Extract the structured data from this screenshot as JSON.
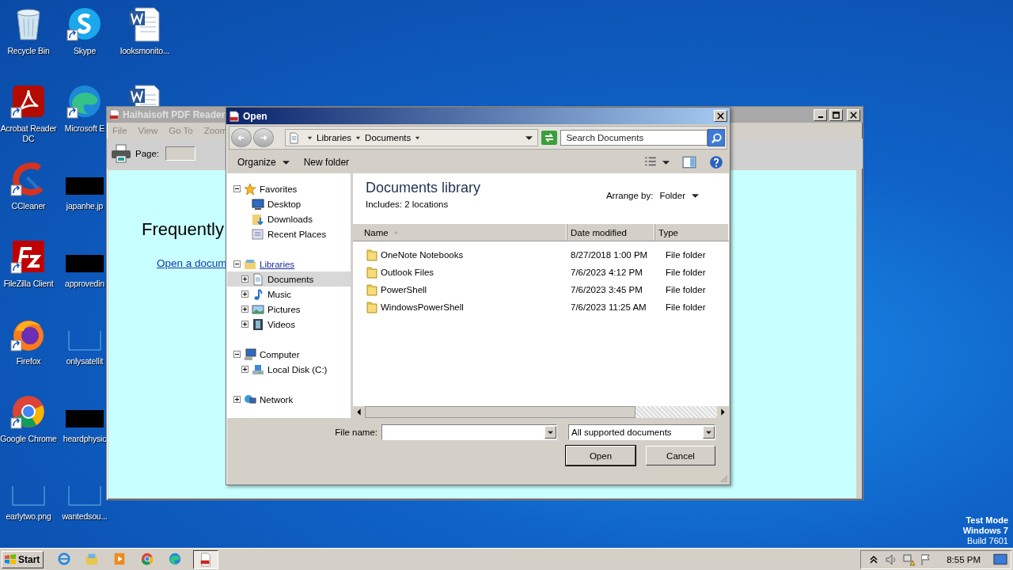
{
  "desktop": {
    "icons": [
      {
        "label": "Recycle Bin",
        "kind": "recycle",
        "shortcut": false
      },
      {
        "label": "Acrobat Reader DC",
        "kind": "acrobat",
        "shortcut": true
      },
      {
        "label": "CCleaner",
        "kind": "ccleaner",
        "shortcut": true
      },
      {
        "label": "FileZilla Client",
        "kind": "filezilla",
        "shortcut": true
      },
      {
        "label": "Firefox",
        "kind": "firefox",
        "shortcut": true
      },
      {
        "label": "Google Chrome",
        "kind": "chrome",
        "shortcut": true
      },
      {
        "label": "earlytwo.png",
        "kind": "blank",
        "shortcut": false
      },
      {
        "label": "Skype",
        "kind": "skype",
        "shortcut": true
      },
      {
        "label": "Microsoft E",
        "kind": "edge",
        "shortcut": true
      },
      {
        "label": "japanhe.jp",
        "kind": "redacted",
        "shortcut": false
      },
      {
        "label": "approvedin",
        "kind": "redacted",
        "shortcut": false
      },
      {
        "label": "onlysatellit",
        "kind": "blank",
        "shortcut": false
      },
      {
        "label": "heardphysic",
        "kind": "redacted",
        "shortcut": false
      },
      {
        "label": "wantedsou...",
        "kind": "blank",
        "shortcut": false
      },
      {
        "label": "looksmonito...",
        "kind": "word",
        "shortcut": false
      },
      {
        "kind": "word"
      }
    ]
  },
  "pdf_reader": {
    "title": "Haihaisoft PDF Reader",
    "menu": [
      "File",
      "View",
      "Go To",
      "Zoom"
    ],
    "page_label": "Page:",
    "heading": "Frequently",
    "link": "Open a docum"
  },
  "open_dialog": {
    "title": "Open",
    "breadcrumb": [
      "Libraries",
      "Documents"
    ],
    "search": {
      "placeholder": "Search Documents"
    },
    "toolbar": {
      "organize": "Organize",
      "new_folder": "New folder"
    },
    "navigation": [
      {
        "label": "Favorites",
        "kind": "star",
        "expanded": true,
        "selected": false,
        "hovered": false,
        "children": [
          {
            "label": "Desktop",
            "kind": "desktop",
            "selected": false,
            "hovered": false
          },
          {
            "label": "Downloads",
            "kind": "downloads",
            "selected": false,
            "hovered": false
          },
          {
            "label": "Recent Places",
            "kind": "recent",
            "selected": false,
            "hovered": false
          }
        ]
      },
      {
        "label": "Libraries",
        "kind": "library",
        "expanded": true,
        "selected": false,
        "hovered": true,
        "children": [
          {
            "label": "Documents",
            "kind": "document",
            "expanded": false,
            "selected": true,
            "hovered": false
          },
          {
            "label": "Music",
            "kind": "music",
            "expanded": false,
            "selected": false,
            "hovered": false
          },
          {
            "label": "Pictures",
            "kind": "pictures",
            "expanded": false,
            "selected": false,
            "hovered": false
          },
          {
            "label": "Videos",
            "kind": "videos",
            "expanded": false,
            "selected": false,
            "hovered": false
          }
        ]
      },
      {
        "label": "Computer",
        "kind": "computer",
        "expanded": true,
        "selected": false,
        "hovered": false,
        "children": [
          {
            "label": "Local Disk (C:)",
            "kind": "disk",
            "expanded": false,
            "selected": false,
            "hovered": false
          }
        ]
      },
      {
        "label": "Network",
        "kind": "network",
        "expanded": false,
        "selected": false,
        "hovered": false
      }
    ],
    "library": {
      "title": "Documents library",
      "includes": "Includes:  2 locations",
      "arrange_label": "Arrange by:",
      "arrange_value": "Folder"
    },
    "columns": [
      {
        "label": "Name",
        "sorted": true
      },
      {
        "label": "Date modified",
        "sorted": false
      },
      {
        "label": "Type",
        "sorted": false
      }
    ],
    "files": [
      {
        "name": "OneNote Notebooks",
        "date": "8/27/2018 1:00 PM",
        "type": "File folder"
      },
      {
        "name": "Outlook Files",
        "date": "7/6/2023 4:12 PM",
        "type": "File folder"
      },
      {
        "name": "PowerShell",
        "date": "7/6/2023 3:45 PM",
        "type": "File folder"
      },
      {
        "name": "WindowsPowerShell",
        "date": "7/6/2023 11:25 AM",
        "type": "File folder"
      }
    ],
    "file_name_label": "File name:",
    "filter": "All supported documents",
    "buttons": [
      "Open",
      "Cancel"
    ]
  },
  "os_notice": [
    "Test Mode",
    "Windows 7",
    "Build 7601"
  ],
  "taskbar": {
    "start": "Start",
    "apps": [
      {
        "kind": "ie",
        "active": false
      },
      {
        "kind": "explorer",
        "active": false
      },
      {
        "kind": "media",
        "active": false
      },
      {
        "kind": "chrome",
        "active": false
      },
      {
        "kind": "edge",
        "active": false
      },
      {
        "kind": "pdf",
        "active": true
      }
    ],
    "clock": "8:55 PM"
  }
}
